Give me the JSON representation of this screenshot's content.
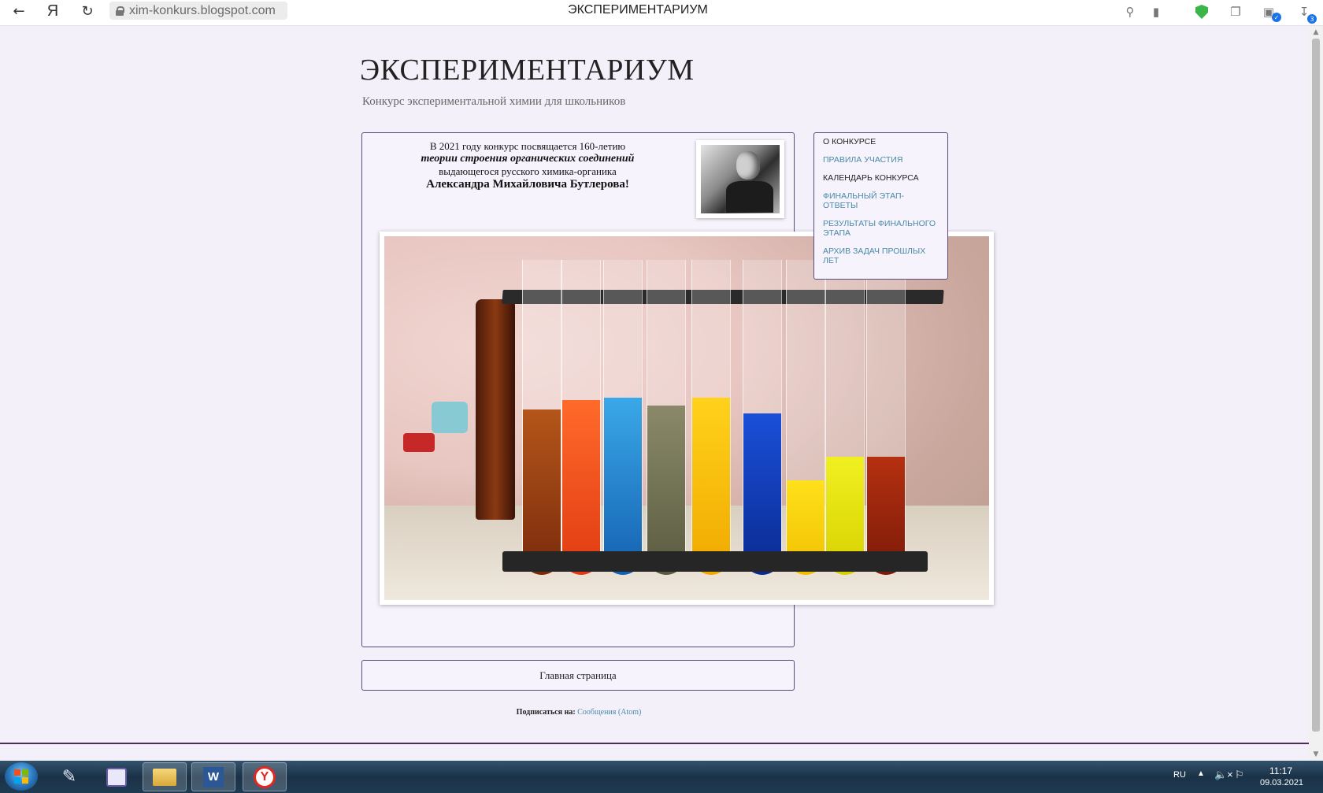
{
  "browser": {
    "url": "xim-konkurs.blogspot.com",
    "tab_title": "ЭКСПЕРИМЕНТАРИУМ",
    "extension_badge": "3"
  },
  "blog": {
    "title": "ЭКСПЕРИМЕНТАРИУМ",
    "description": "Конкурс экспериментальной химии для школьников"
  },
  "post": {
    "line1": "В 2021 году конкурс посвящается 160-летию",
    "line2": "теории строения органических соединений",
    "line3": "выдающегося русского химика-органика",
    "line4": "Александра Михайловича Бутлерова!"
  },
  "sidebar": {
    "items": [
      {
        "label": "О конкурсе",
        "style": "dark"
      },
      {
        "label": "Правила участия",
        "style": "link"
      },
      {
        "label": "Календарь конкурса",
        "style": "dark"
      },
      {
        "label": "Финальный этап-ответы",
        "style": "link"
      },
      {
        "label": "Результаты финального этапа",
        "style": "link"
      },
      {
        "label": "Архив задач прошлых лет",
        "style": "link"
      }
    ]
  },
  "footer": {
    "home_link": "Главная страница",
    "subscribe_label": "Подписаться на:",
    "subscribe_link": "Сообщения (Atom)"
  },
  "taskbar": {
    "language": "RU",
    "time": "11:17",
    "date": "09.03.2021"
  },
  "colors": {
    "page_bg": "#f3f0fa",
    "box_border": "#5b4a7a",
    "link": "#4a8aa6"
  }
}
